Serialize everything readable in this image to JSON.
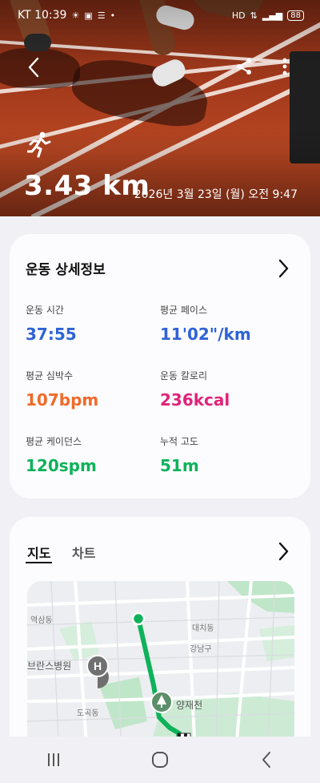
{
  "status_bar": {
    "carrier_time": "KT 10:39",
    "battery": "88",
    "icons": [
      "sun-icon",
      "app-icon",
      "mail-icon",
      "hd-icon",
      "volte-icon",
      "signal-icon",
      "battery-icon"
    ]
  },
  "header": {
    "activity_icon": "running-icon",
    "distance": "3.43 km",
    "datetime": "2026년 3월 23일 (월) 오전 9:47"
  },
  "details": {
    "title": "운동 상세정보",
    "metrics": [
      {
        "label": "운동 시간",
        "value": "37:55",
        "color": "#2f63d6"
      },
      {
        "label": "평균 페이스",
        "value": "11'02\"/km",
        "color": "#2f63d6"
      },
      {
        "label": "평균 심박수",
        "value": "107bpm",
        "color": "#f06a2a"
      },
      {
        "label": "운동 칼로리",
        "value": "236kcal",
        "color": "#e0247a"
      },
      {
        "label": "평균 케이던스",
        "value": "120spm",
        "color": "#0db25a"
      },
      {
        "label": "누적 고도",
        "value": "51m",
        "color": "#0db25a"
      }
    ]
  },
  "map_section": {
    "tabs": [
      "지도",
      "차트"
    ],
    "active_tab": "지도",
    "labels": [
      "역삼동",
      "대치동",
      "강남구",
      "브란스병원",
      "도곡동",
      "양재천"
    ],
    "route_color": "#0db25a"
  },
  "nav": {
    "icons": [
      "recent-apps-icon",
      "home-icon",
      "back-icon"
    ]
  }
}
